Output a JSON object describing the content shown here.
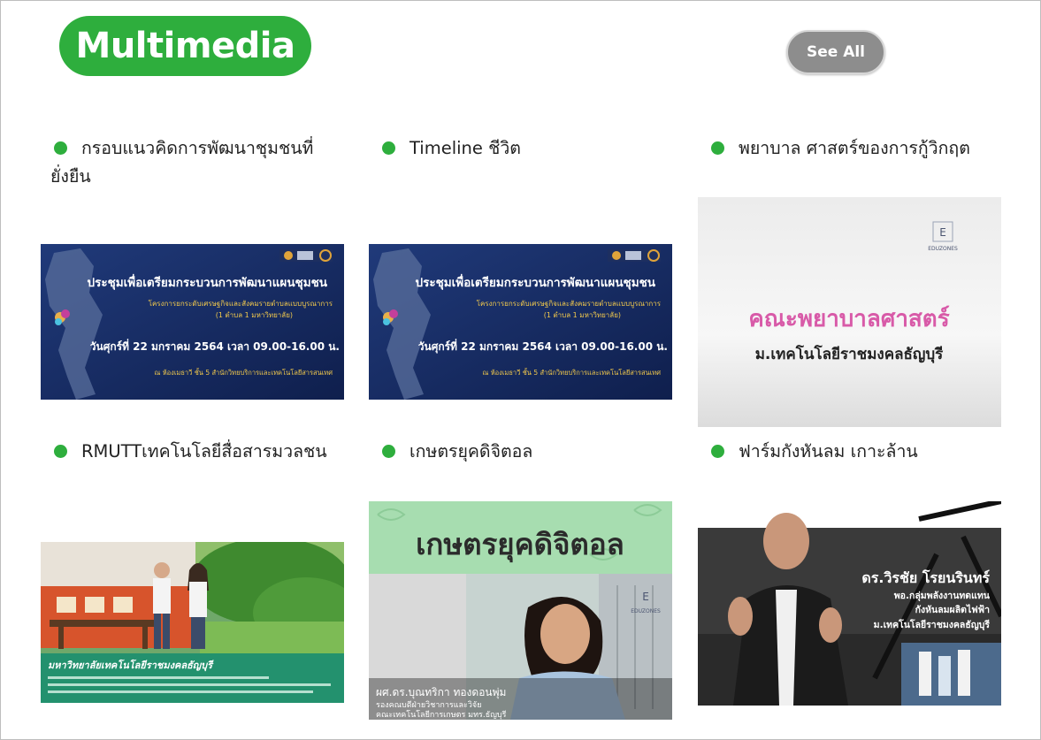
{
  "header": {
    "title": "Multimedia",
    "see_all": "See All"
  },
  "colors": {
    "accent": "#2eae3d",
    "button": "#8d8d8d"
  },
  "items": [
    {
      "title": "กรอบแนวคิดการพัฒนาชุมชนที่ยั่งยืน",
      "title_line1": "กรอบแนวคิดการพัฒนาชุมชนที่",
      "title_line2": "ยั่งยืน",
      "thumb": {
        "heading": "ประชุมเพื่อเตรียมกระบวนการพัฒนาแผนชุมชน",
        "sub1": "โครงการยกระดับเศรษฐกิจและสังคมรายตำบลแบบบูรณาการ",
        "sub2": "(1 ตำบล 1 มหาวิทยาลัย)",
        "date": "วันศุกร์ที่ 22 มกราคม 2564 เวลา 09.00-16.00 น.",
        "place": "ณ ห้องเมธาวี ชั้น 5 สำนักวิทยบริการและเทคโนโลยีสารสนเทศ"
      }
    },
    {
      "title": "Timeline ชีวิต",
      "thumb": {
        "heading": "ประชุมเพื่อเตรียมกระบวนการพัฒนาแผนชุมชน",
        "sub1": "โครงการยกระดับเศรษฐกิจและสังคมรายตำบลแบบบูรณาการ",
        "sub2": "(1 ตำบล 1 มหาวิทยาลัย)",
        "date": "วันศุกร์ที่ 22 มกราคม 2564 เวลา 09.00-16.00 น.",
        "place": "ณ ห้องเมธาวี ชั้น 5 สำนักวิทยบริการและเทคโนโลยีสารสนเทศ"
      }
    },
    {
      "title": "พยาบาล ศาสตร์ของการกู้วิกฤต",
      "thumb": {
        "logo": "E",
        "brand": "EDUZONES",
        "heading": "คณะพยาบาลศาสตร์",
        "sub": "ม.เทคโนโลยีราชมงคลธัญบุรี"
      }
    },
    {
      "title": "RMUTTเทคโนโลยีสื่อสารมวลชน",
      "thumb": {
        "banner": "มหาวิทยาลัยเทคโนโลยีราชมงคลธัญบุรี"
      }
    },
    {
      "title": "เกษตรยุคดิจิตอล",
      "thumb": {
        "heading": "เกษตรยุคดิจิตอล",
        "logo": "E",
        "brand": "EDUZONES",
        "name": "ผศ.ดร.บุณทริกา ทองดอนพุ่ม",
        "role1": "รองคณบดีฝ่ายวิชาการและวิจัย",
        "role2": "คณะเทคโนโลยีการเกษตร มทร.ธัญบุรี"
      }
    },
    {
      "title": "ฟาร์มกังหันลม เกาะล้าน",
      "thumb": {
        "name": "ดร.วิรชัย โรยนรินทร์",
        "role1": "พอ.กลุ่มพลังงานทดแทน",
        "role2": "กังหันลมผลิตไฟฟ้า",
        "role3": "ม.เทคโนโลยีราชมงคลธัญบุรี"
      }
    }
  ]
}
